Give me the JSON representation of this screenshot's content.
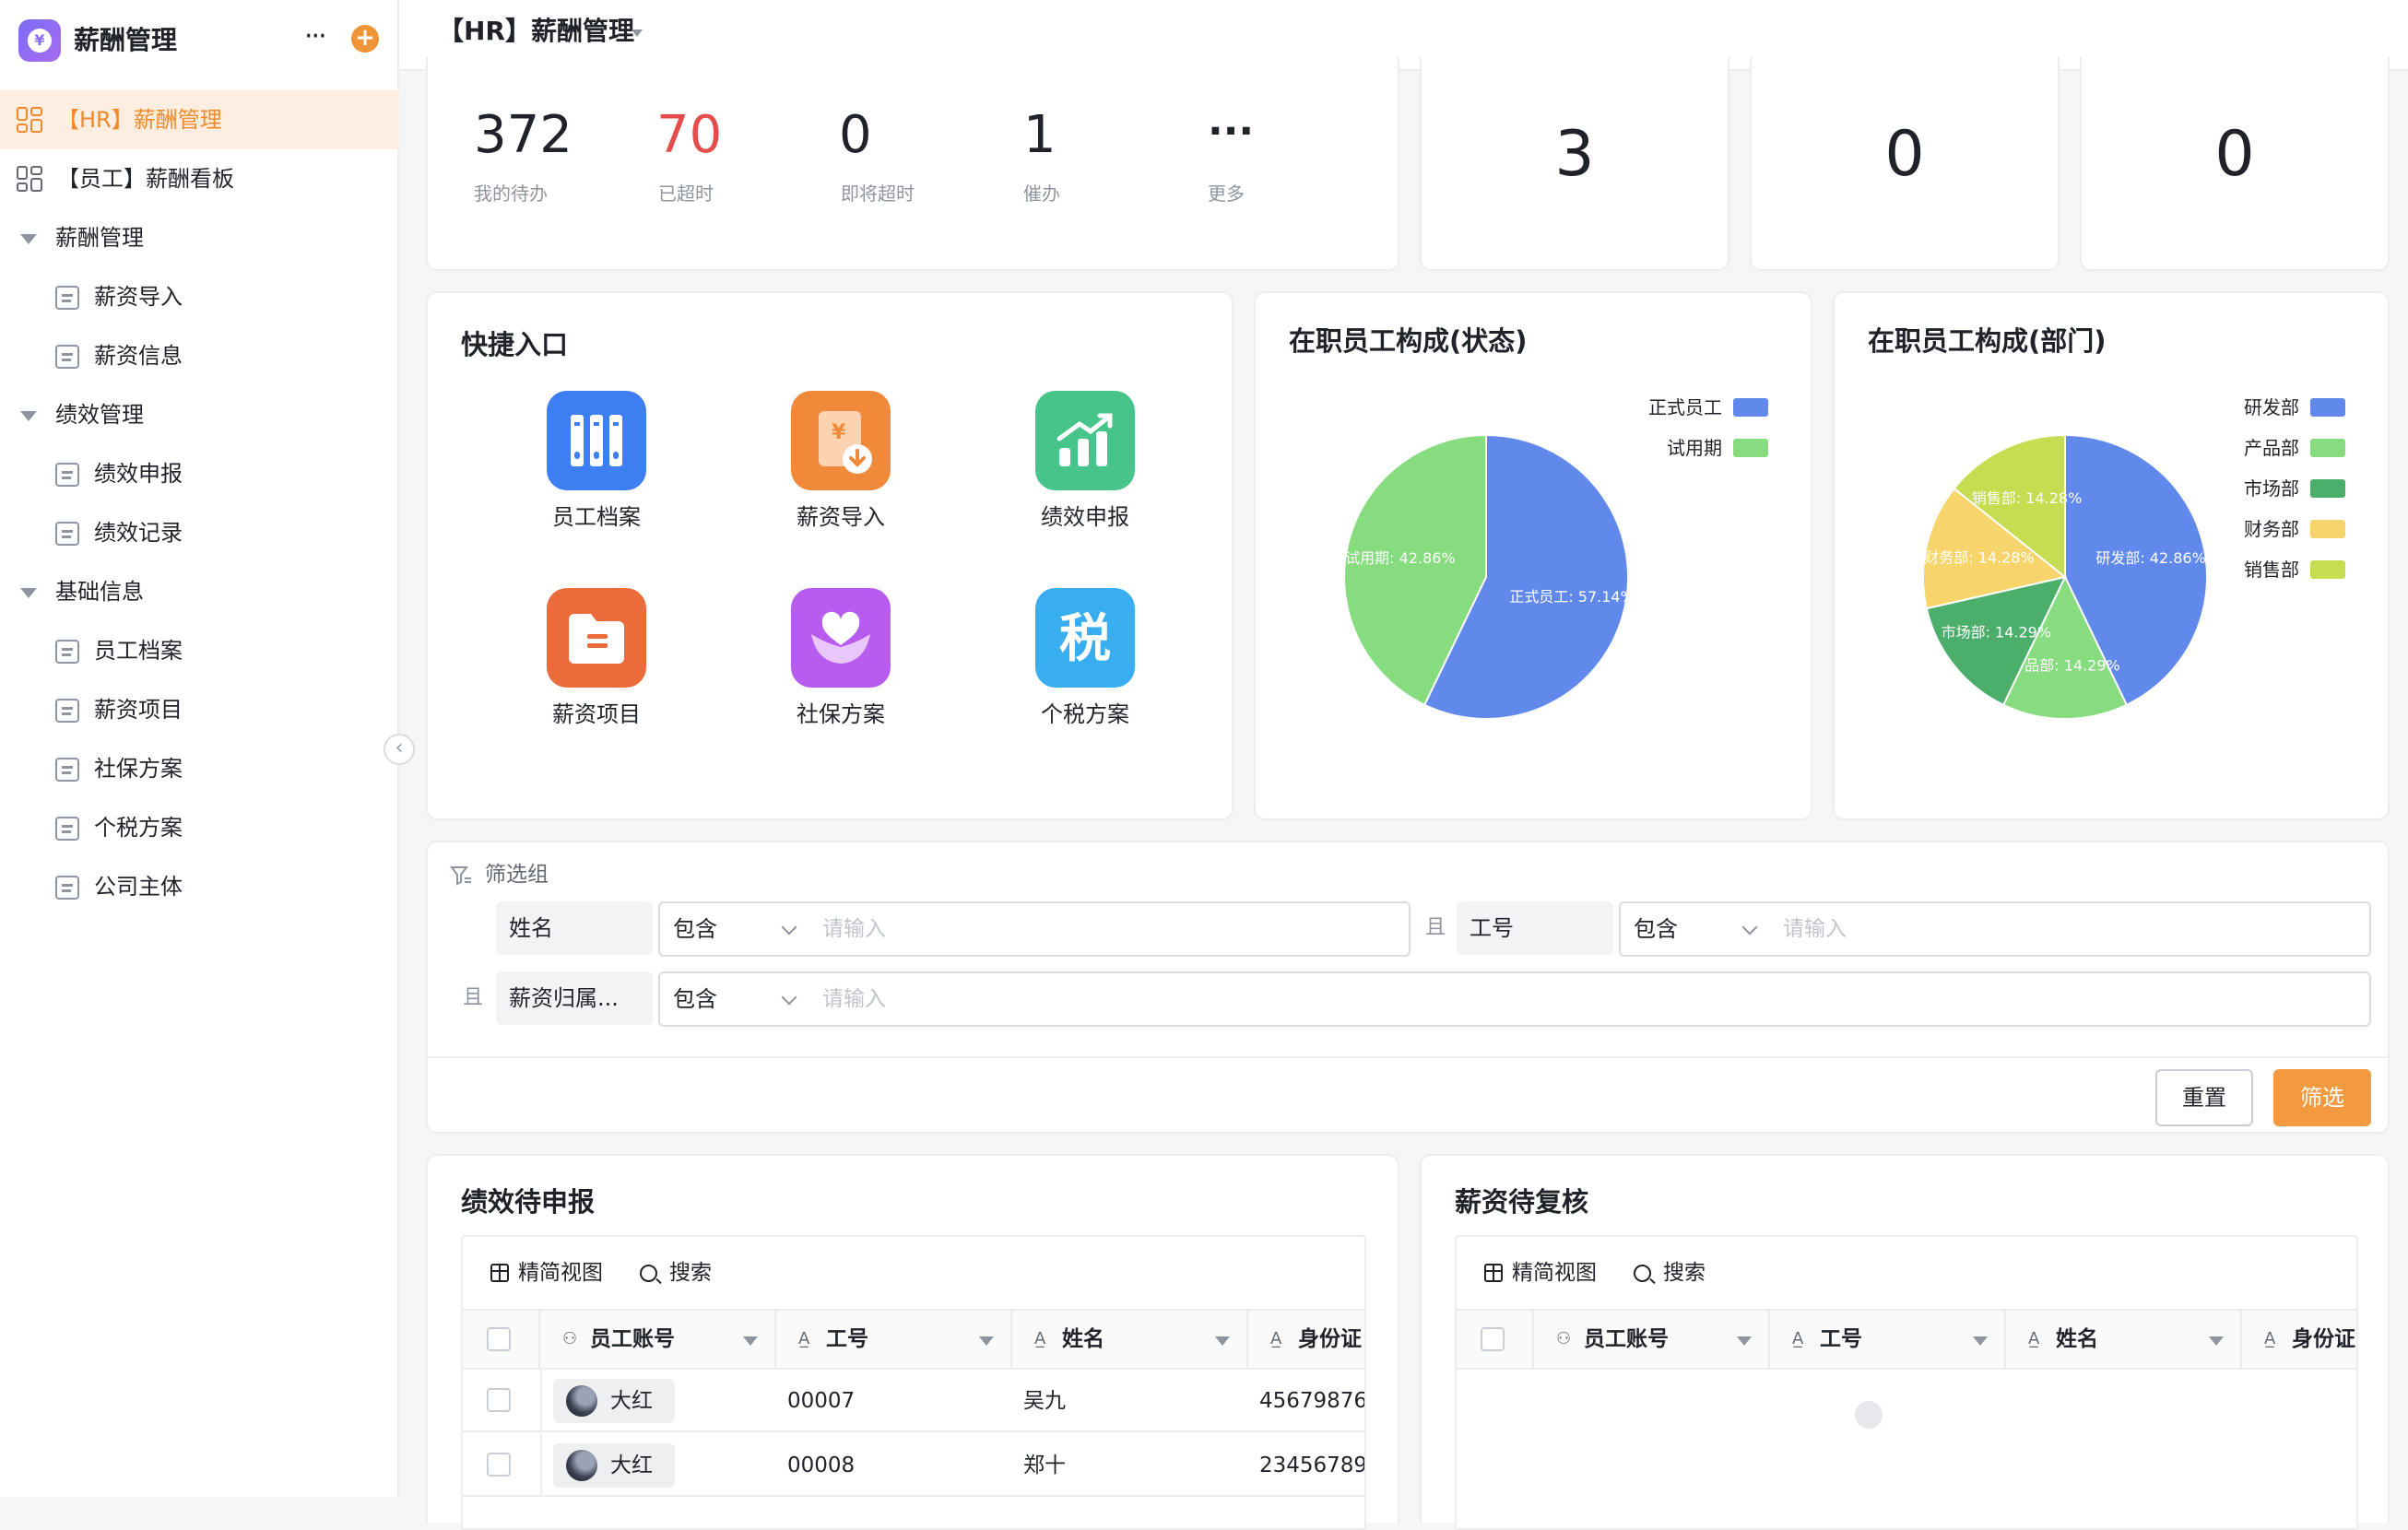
{
  "app": {
    "name": "薪酬管理",
    "logo_glyph": "¥"
  },
  "sidebar": {
    "items": [
      {
        "label": "【HR】薪酬管理",
        "kind": "board",
        "active": true
      },
      {
        "label": "【员工】薪酬看板",
        "kind": "board",
        "active": false
      },
      {
        "label": "薪酬管理",
        "kind": "group"
      },
      {
        "label": "薪资导入",
        "kind": "page"
      },
      {
        "label": "薪资信息",
        "kind": "page"
      },
      {
        "label": "绩效管理",
        "kind": "group"
      },
      {
        "label": "绩效申报",
        "kind": "page"
      },
      {
        "label": "绩效记录",
        "kind": "page"
      },
      {
        "label": "基础信息",
        "kind": "group"
      },
      {
        "label": "员工档案",
        "kind": "page"
      },
      {
        "label": "薪资项目",
        "kind": "page"
      },
      {
        "label": "社保方案",
        "kind": "page"
      },
      {
        "label": "个税方案",
        "kind": "page"
      },
      {
        "label": "公司主体",
        "kind": "page"
      }
    ]
  },
  "header": {
    "title": "【HR】薪酬管理"
  },
  "stats": {
    "todo": {
      "value": "372",
      "label": "我的待办"
    },
    "overdue": {
      "value": "70",
      "label": "已超时"
    },
    "due_soon": {
      "value": "0",
      "label": "即将超时"
    },
    "urged": {
      "value": "1",
      "label": "催办"
    },
    "more": {
      "value": "···",
      "label": "更多"
    }
  },
  "metric_cards": [
    "3",
    "0",
    "0"
  ],
  "quick": {
    "title": "快捷入口",
    "tiles": [
      {
        "label": "员工档案",
        "icon": "archive-icon",
        "color": "#3d7ff2"
      },
      {
        "label": "薪资导入",
        "icon": "salary-import-icon",
        "color": "#f08a3a"
      },
      {
        "label": "绩效申报",
        "icon": "chart-up-icon",
        "color": "#46c489"
      },
      {
        "label": "薪资项目",
        "icon": "folder-icon",
        "color": "#ec6b3b"
      },
      {
        "label": "社保方案",
        "icon": "heart-hand-icon",
        "color": "#b85cf0"
      },
      {
        "label": "个税方案",
        "icon": "tax-icon",
        "color": "#38aef0"
      }
    ]
  },
  "chart_data": [
    {
      "type": "pie",
      "title": "在职员工构成(状态)",
      "legend_position": "top-right",
      "categories": [
        "正式员工",
        "试用期"
      ],
      "values": [
        57.14,
        42.86
      ],
      "data_labels": [
        "正式员工: 57.14%",
        "试用期: 42.86%"
      ],
      "colors": [
        "#6189ec",
        "#86dc7e"
      ]
    },
    {
      "type": "pie",
      "title": "在职员工构成(部门)",
      "legend_position": "top-right",
      "categories": [
        "研发部",
        "产品部",
        "市场部",
        "财务部",
        "销售部"
      ],
      "values": [
        42.86,
        14.29,
        14.29,
        14.28,
        14.28
      ],
      "data_labels": [
        "研发部: 42.86%",
        "产品部: 14.29%",
        "市场部: 14.29%",
        "财务部: 14.28%",
        "销售部: 14.28%"
      ],
      "colors": [
        "#6189ec",
        "#86dc7e",
        "#4cae6b",
        "#f8d46c",
        "#c6dd52"
      ]
    }
  ],
  "filter": {
    "title": "筛选组",
    "and": "且",
    "rows": [
      {
        "field": "姓名",
        "op": "包含",
        "placeholder": "请输入"
      },
      {
        "field": "工号",
        "op": "包含",
        "placeholder": "请输入"
      },
      {
        "field": "薪资归属...",
        "op": "包含",
        "placeholder": "请输入"
      }
    ],
    "reset": "重置",
    "submit": "筛选"
  },
  "perf_table": {
    "title": "绩效待申报",
    "view_label": "精简视图",
    "search_label": "搜索",
    "columns": [
      {
        "label": "员工账号",
        "icon": "person-icon"
      },
      {
        "label": "工号",
        "icon": "text-field-icon"
      },
      {
        "label": "姓名",
        "icon": "text-field-icon"
      },
      {
        "label": "身份证",
        "icon": "text-field-icon"
      }
    ],
    "rows": [
      {
        "account": "大红",
        "emp_no": "00007",
        "name": "吴九",
        "id_card": "45679876"
      },
      {
        "account": "大红",
        "emp_no": "00008",
        "name": "郑十",
        "id_card": "23456789"
      }
    ]
  },
  "salary_table": {
    "title": "薪资待复核",
    "view_label": "精简视图",
    "search_label": "搜索",
    "columns": [
      {
        "label": "员工账号",
        "icon": "person-icon"
      },
      {
        "label": "工号",
        "icon": "text-field-icon"
      },
      {
        "label": "姓名",
        "icon": "text-field-icon"
      },
      {
        "label": "身份证",
        "icon": "text-field-icon"
      }
    ],
    "rows": []
  }
}
